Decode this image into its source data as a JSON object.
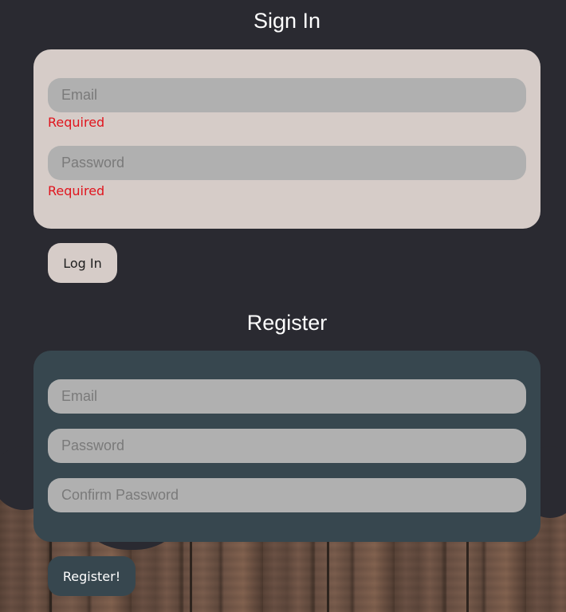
{
  "signin": {
    "title": "Sign In",
    "email_placeholder": "Email",
    "email_error": "Required",
    "password_placeholder": "Password",
    "password_error": "Required",
    "login_label": "Log In"
  },
  "register": {
    "title": "Register",
    "email_placeholder": "Email",
    "password_placeholder": "Password",
    "confirm_placeholder": "Confirm Password",
    "register_label": "Register!"
  },
  "colors": {
    "page_background": "#2a2a31",
    "signin_card": "#d6ccc8",
    "register_card": "#37474f",
    "input_background": "#b0b0b0",
    "error": "#e0141d"
  }
}
